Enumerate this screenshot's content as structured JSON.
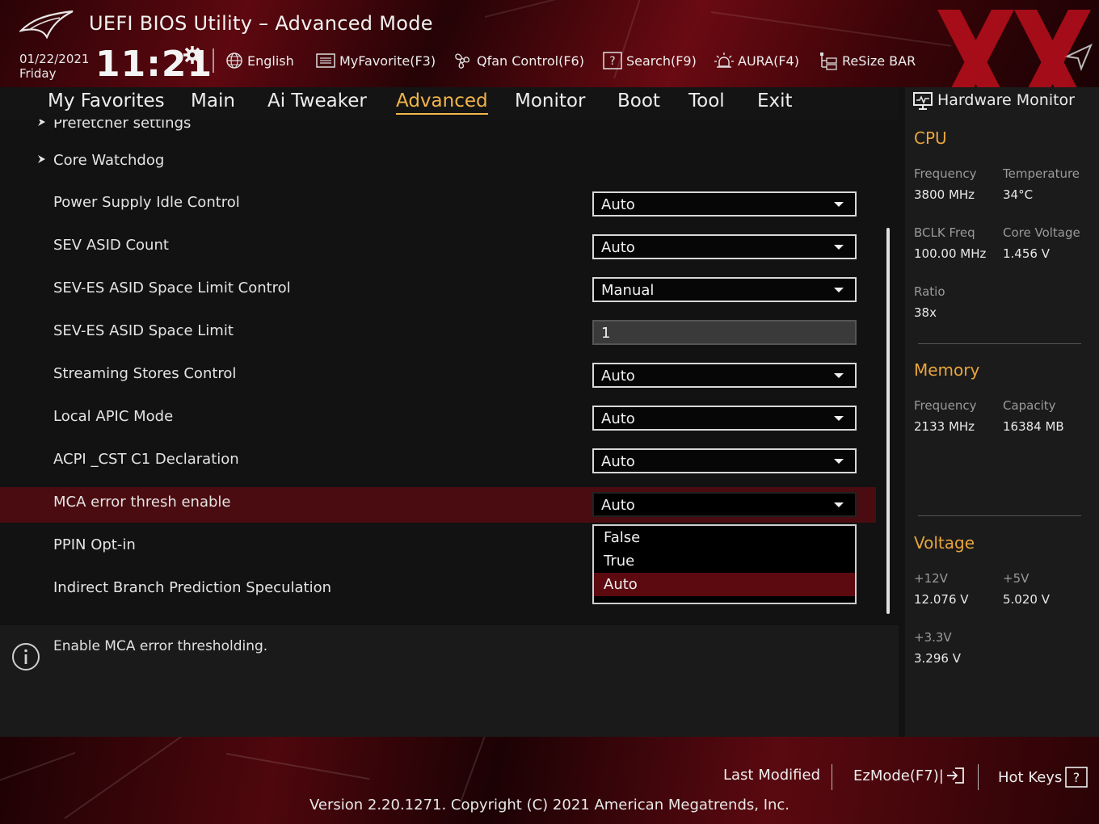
{
  "header": {
    "title": "UEFI BIOS Utility – Advanced Mode",
    "date": "01/22/2021",
    "day": "Friday",
    "time": "11:21",
    "tools": {
      "language": "English",
      "favorite": "MyFavorite(F3)",
      "qfan": "Qfan Control(F6)",
      "search": "Search(F9)",
      "aura": "AURA(F4)",
      "resize": "ReSize BAR"
    }
  },
  "nav": {
    "tabs": [
      "My Favorites",
      "Main",
      "Ai Tweaker",
      "Advanced",
      "Monitor",
      "Boot",
      "Tool",
      "Exit"
    ],
    "active": "Advanced"
  },
  "settings": {
    "partial_label": "Prefetcher settings",
    "core_watchdog": "Core Watchdog",
    "rows": [
      {
        "label": "Power Supply Idle Control",
        "value": "Auto"
      },
      {
        "label": "SEV ASID Count",
        "value": "Auto"
      },
      {
        "label": "SEV-ES ASID Space Limit Control",
        "value": "Manual"
      },
      {
        "label": "SEV-ES ASID Space Limit",
        "value": "1"
      },
      {
        "label": "Streaming Stores Control",
        "value": "Auto"
      },
      {
        "label": "Local APIC Mode",
        "value": "Auto"
      },
      {
        "label": "ACPI _CST C1 Declaration",
        "value": "Auto"
      },
      {
        "label": "MCA error thresh enable",
        "value": "Auto"
      },
      {
        "label": "PPIN Opt-in",
        "value": ""
      },
      {
        "label": "Indirect Branch Prediction Speculation",
        "value": ""
      }
    ],
    "dropdown_options": [
      "False",
      "True",
      "Auto"
    ],
    "dropdown_selected": "Auto"
  },
  "help": {
    "text": "Enable MCA error thresholding."
  },
  "hw_monitor": {
    "title": "Hardware Monitor",
    "cpu": {
      "heading": "CPU",
      "frequency_label": "Frequency",
      "frequency": "3800 MHz",
      "temperature_label": "Temperature",
      "temperature": "34°C",
      "bclk_label": "BCLK Freq",
      "bclk": "100.00 MHz",
      "core_voltage_label": "Core Voltage",
      "core_voltage": "1.456 V",
      "ratio_label": "Ratio",
      "ratio": "38x"
    },
    "memory": {
      "heading": "Memory",
      "frequency_label": "Frequency",
      "frequency": "2133 MHz",
      "capacity_label": "Capacity",
      "capacity": "16384 MB"
    },
    "voltage": {
      "heading": "Voltage",
      "v12_label": "+12V",
      "v12": "12.076 V",
      "v5_label": "+5V",
      "v5": "5.020 V",
      "v33_label": "+3.3V",
      "v33": "3.296 V"
    }
  },
  "footer": {
    "last_modified": "Last Modified",
    "ezmode": "EzMode(F7)|",
    "hotkeys": "Hot Keys",
    "version": "Version 2.20.1271. Copyright (C) 2021 American Megatrends, Inc."
  },
  "colors": {
    "accent": "#f2b54a",
    "brand_red": "#c8101e",
    "highlight_row": "#4a0c10",
    "section_heading": "#e8a53c"
  }
}
